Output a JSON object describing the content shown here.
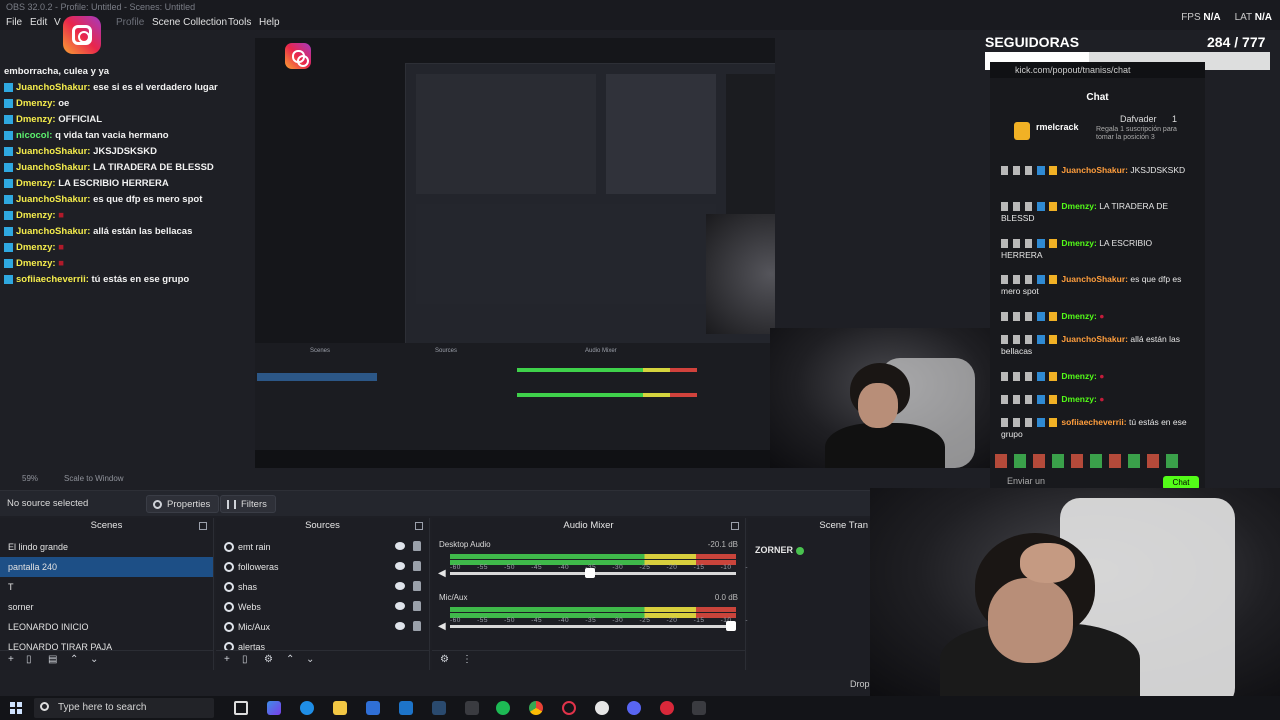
{
  "window": {
    "title": "OBS 32.0.2 - Profile: Untitled - Scenes: Untitled"
  },
  "menu": [
    "File",
    "Edit",
    "V",
    "Profile",
    "Scene Collection",
    "Tools",
    "Help"
  ],
  "status": {
    "fps_label": "FPS",
    "fps_value": "N/A",
    "lat_label": "LAT",
    "lat_value": "N/A"
  },
  "followers_goal": {
    "label": "SEGUIDORAS",
    "count": "284 / 777",
    "progress": 0.365
  },
  "overlay_chat": [
    {
      "name": "",
      "text": "emborracha, culea y ya"
    },
    {
      "name": "JuanchoShakur:",
      "text": "ese si es el verdadero lugar"
    },
    {
      "name": "Dmenzy:",
      "text": "oe"
    },
    {
      "name": "Dmenzy:",
      "text": "OFFICIAL"
    },
    {
      "name": "nicocol:",
      "text": "q vida tan vacia hermano"
    },
    {
      "name": "JuanchoShakur:",
      "text": "JKSJDSKSKD"
    },
    {
      "name": "JuanchoShakur:",
      "text": "LA TIRADERA DE BLESSD"
    },
    {
      "name": "Dmenzy:",
      "text": "LA ESCRIBIO HERRERA"
    },
    {
      "name": "JuanchoShakur:",
      "text": "es que dfp es mero spot"
    },
    {
      "name": "Dmenzy:",
      "text": ""
    },
    {
      "name": "JuanchoShakur:",
      "text": "allá están las bellacas"
    },
    {
      "name": "Dmenzy:",
      "text": ""
    },
    {
      "name": "Dmenzy:",
      "text": ""
    },
    {
      "name": "sofiiaecheverrii:",
      "text": "tú estás en ese grupo"
    }
  ],
  "kick_chat": {
    "url": "kick.com/popout/tnaniss/chat",
    "title": "Chat",
    "top_user": "rmelcrack",
    "top_defender": "Dafvader",
    "top_number": "1",
    "top_note": "Regala 1 suscripción para tomar la posición 3",
    "messages": [
      {
        "name": "JuanchoShakur:",
        "text": "JKSJDSKSKD"
      },
      {
        "name": "Dmenzy:",
        "text": "LA TIRADERA DE BLESSD"
      },
      {
        "name": "Dmenzy:",
        "text": "LA ESCRIBIO HERRERA"
      },
      {
        "name": "JuanchoShakur:",
        "text": "es que dfp es mero spot"
      },
      {
        "name": "Dmenzy:",
        "text": ""
      },
      {
        "name": "JuanchoShakur:",
        "text": "allá están las bellacas"
      },
      {
        "name": "Dmenzy:",
        "text": ""
      },
      {
        "name": "Dmenzy:",
        "text": ""
      },
      {
        "name": "sofiiaecheverrii:",
        "text": "tú estás en ese grupo"
      }
    ],
    "send_placeholder": "Enviar un",
    "chat_button": "Chat"
  },
  "preview": {
    "zoom": "59%",
    "scale_label": "Scale to Window"
  },
  "source_toolbar": {
    "no_source": "No source selected",
    "properties": "Properties",
    "filters": "Filters"
  },
  "scenes": {
    "title": "Scenes",
    "items": [
      "El lindo grande",
      "pantalla 240",
      "T",
      "sorner",
      "LEONARDO INICIO",
      "LEONARDO TIRAR PAJA"
    ],
    "selected": 1
  },
  "sources": {
    "title": "Sources",
    "items": [
      "emt rain",
      "followeras",
      "shas",
      "Webs",
      "Mic/Aux",
      "alertas"
    ]
  },
  "audio_mixer": {
    "title": "Audio Mixer",
    "channels": [
      {
        "name": "Desktop Audio",
        "db": "-20.1 dB",
        "volume": 0.49
      },
      {
        "name": "Mic/Aux",
        "db": "0.0 dB",
        "volume": 1.0
      }
    ],
    "scale": [
      "-60",
      "-55",
      "-50",
      "-45",
      "-40",
      "-35",
      "-30",
      "-25",
      "-20",
      "-15",
      "-10",
      "-5",
      "0"
    ]
  },
  "scene_transitions": {
    "title": "Scene Tran",
    "zorner_label": "ZORNER"
  },
  "drop_text": "Drop",
  "taskbar": {
    "search_placeholder": "Type here to search"
  },
  "colors": {
    "accent_select": "#1d4f86",
    "kick_green": "#53fc18",
    "chat_name_yellow": "#f4ec4c",
    "chat_name_green": "#5cf06e",
    "obs_bg": "#1d1e24"
  }
}
